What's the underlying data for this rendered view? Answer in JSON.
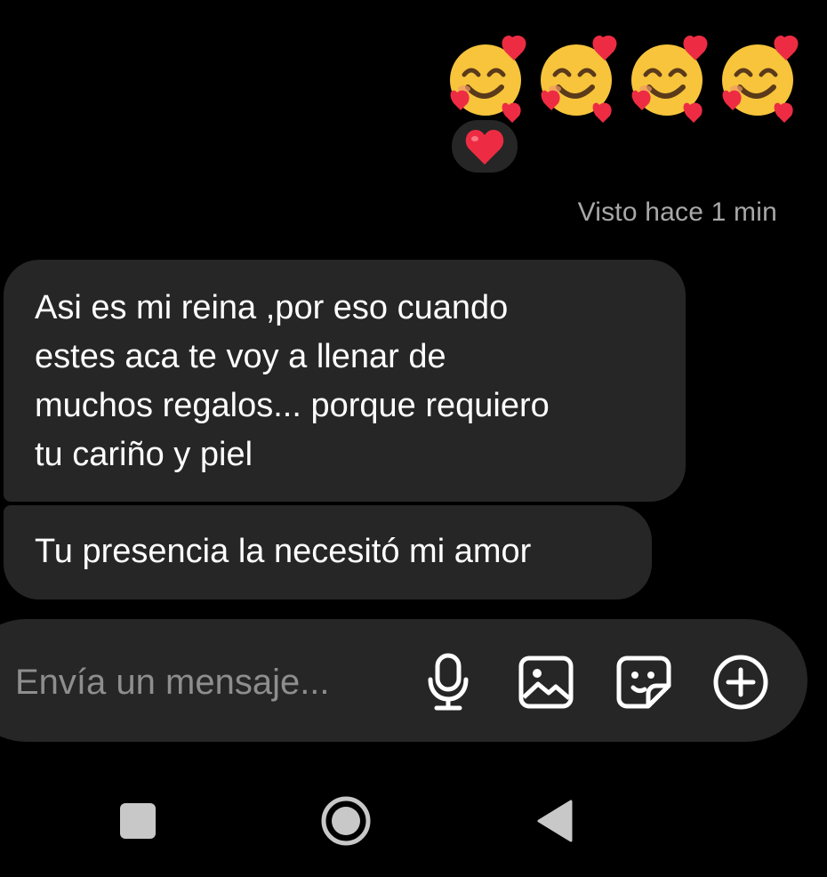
{
  "sent_message": {
    "emojis": [
      "smiling-face-with-hearts",
      "smiling-face-with-hearts",
      "smiling-face-with-hearts",
      "smiling-face-with-hearts"
    ],
    "reaction_icon": "red-heart",
    "seen_status": "Visto hace 1 min"
  },
  "received_messages": [
    {
      "lines": [
        "Asi es mi reina ,por eso cuando",
        "estes aca te voy a llenar de",
        "muchos regalos... porque requiero",
        "tu cariño y piel"
      ]
    },
    {
      "text": "Tu presencia la necesitó mi amor"
    }
  ],
  "composer": {
    "placeholder": "Envía un mensaje...",
    "icons": [
      "microphone-icon",
      "gallery-icon",
      "sticker-icon",
      "plus-icon"
    ]
  },
  "system_nav": {
    "buttons": [
      "recents-button",
      "home-button",
      "back-button"
    ]
  },
  "colors": {
    "background": "#000000",
    "bubble": "#262626",
    "seen_text": "#a8a8a8",
    "placeholder": "#8e8e8e",
    "heart": "#ed2c43",
    "emoji_face": "#f7c43b"
  }
}
